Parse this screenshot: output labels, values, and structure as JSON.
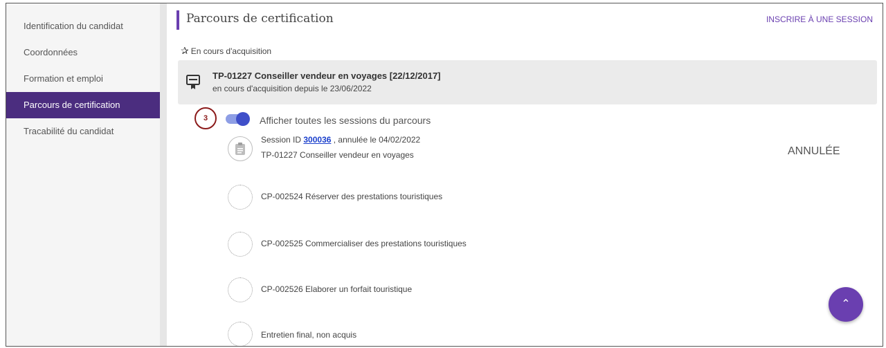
{
  "sidebar": {
    "items": [
      {
        "label": "Identification du candidat"
      },
      {
        "label": "Coordonnées"
      },
      {
        "label": "Formation et emploi"
      },
      {
        "label": "Parcours de certification"
      },
      {
        "label": "Tracabilité du candidat"
      }
    ],
    "active_index": 3
  },
  "header": {
    "title": "Parcours de certification",
    "action_label": "INSCRIRE À UNE SESSION"
  },
  "section": {
    "label": "En cours d'acquisition",
    "icon": "star-icon"
  },
  "certification": {
    "title": "TP-01227 Conseiller vendeur en voyages [22/12/2017]",
    "subtitle": "en cours d'acquisition depuis le 23/06/2022",
    "icon": "certificate-icon"
  },
  "step_badge": "3",
  "toggle": {
    "label": "Afficher toutes les sessions du parcours",
    "checked": true
  },
  "session": {
    "prefix": "Session ID",
    "id": "300036",
    "suffix": ", annulée le 04/02/2022",
    "title": "TP-01227 Conseiller vendeur en voyages",
    "status": "ANNULÉE",
    "icon": "clipboard-icon"
  },
  "modules": [
    {
      "label": "CP-002524 Réserver des prestations touristiques"
    },
    {
      "label": "CP-002525 Commercialiser des prestations touristiques"
    },
    {
      "label": "CP-002526 Elaborer un forfait touristique"
    },
    {
      "label": "Entretien final, non acquis"
    }
  ],
  "fab": {
    "icon": "chevron-up-icon"
  },
  "colors": {
    "accent": "#6a3fb0",
    "sidebar_active": "#4b2d7f",
    "toggle": "#3f4fc9",
    "badge": "#8b1a1a"
  }
}
